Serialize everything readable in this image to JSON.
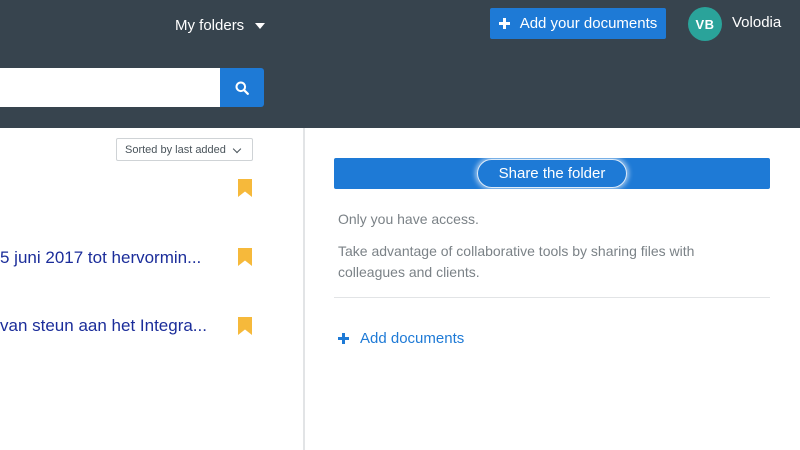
{
  "header": {
    "folders_menu_label": "My folders",
    "add_documents_label": "Add your documents",
    "user": {
      "initials": "VB",
      "name": "Volodia",
      "avatar_color": "#2aa39a"
    }
  },
  "search": {
    "placeholder": "",
    "value": ""
  },
  "list": {
    "sort_label": "Sorted by last added",
    "items": [
      {
        "title": "",
        "bookmarked": true
      },
      {
        "title": "5 juni 2017 tot hervormin...",
        "bookmarked": true
      },
      {
        "title": "van steun aan het Integra...",
        "bookmarked": true
      }
    ]
  },
  "panel": {
    "share_button_label": "Share the folder",
    "access_text": "Only you have access.",
    "collab_text": "Take advantage of collaborative tools by sharing files with colleagues and clients.",
    "add_documents_link": "Add documents"
  },
  "colors": {
    "header_bg": "#37444e",
    "primary": "#1e7ad6",
    "bookmark": "#f6b93b",
    "link_title": "#1b2d9a",
    "muted_text": "#7b8287"
  }
}
